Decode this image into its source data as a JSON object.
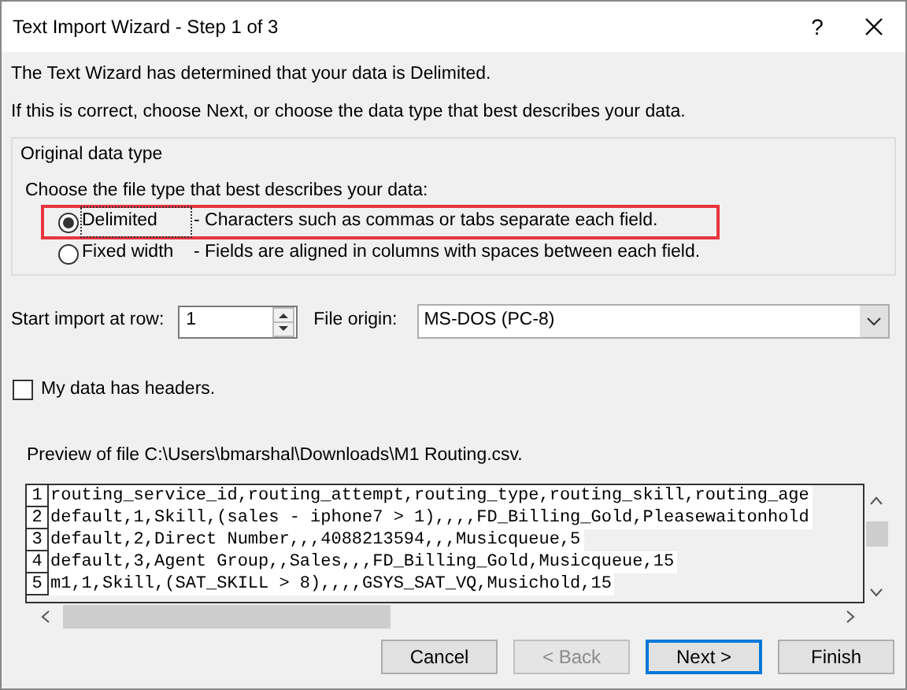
{
  "window": {
    "title": "Text Import Wizard - Step 1 of 3",
    "help": "?"
  },
  "intro": [
    "The Text Wizard has determined that your data is Delimited.",
    "If this is correct, choose Next, or choose the data type that best describes your data."
  ],
  "data_type_group": {
    "legend": "Original data type",
    "prompt": "Choose the file type that best describes your data:",
    "options": [
      {
        "label": "Delimited",
        "description": "- Characters such as commas or tabs separate each field.",
        "selected": true,
        "highlighted": true
      },
      {
        "label": "Fixed width",
        "description": "- Fields are aligned in columns with spaces between each field.",
        "selected": false,
        "highlighted": false
      }
    ]
  },
  "start_row": {
    "label": "Start import at row:",
    "value": "1"
  },
  "file_origin": {
    "label": "File origin:",
    "value": "MS-DOS (PC-8)"
  },
  "headers_checkbox": {
    "label": "My data has headers.",
    "checked": false
  },
  "preview": {
    "label": "Preview of file C:\\Users\\bmarshal\\Downloads\\M1 Routing.csv.",
    "rows": [
      {
        "number": "1",
        "text": "routing_service_id,routing_attempt,routing_type,routing_skill,routing_age"
      },
      {
        "number": "2",
        "text": "default,1,Skill,(sales - iphone7 > 1),,,,FD_Billing_Gold,Pleasewaitonhold"
      },
      {
        "number": "3",
        "text": "default,2,Direct Number,,,4088213594,,,Musicqueue,5"
      },
      {
        "number": "4",
        "text": "default,3,Agent Group,,Sales,,,FD_Billing_Gold,Musicqueue,15"
      },
      {
        "number": "5",
        "text": "m1,1,Skill,(SAT_SKILL > 8),,,,GSYS_SAT_VQ,Musichold,15"
      }
    ]
  },
  "buttons": [
    {
      "label": "Cancel",
      "disabled": false,
      "default": false
    },
    {
      "label": "< Back",
      "disabled": true,
      "default": false
    },
    {
      "label": "Next >",
      "disabled": false,
      "default": true
    },
    {
      "label": "Finish",
      "disabled": false,
      "default": false
    }
  ]
}
